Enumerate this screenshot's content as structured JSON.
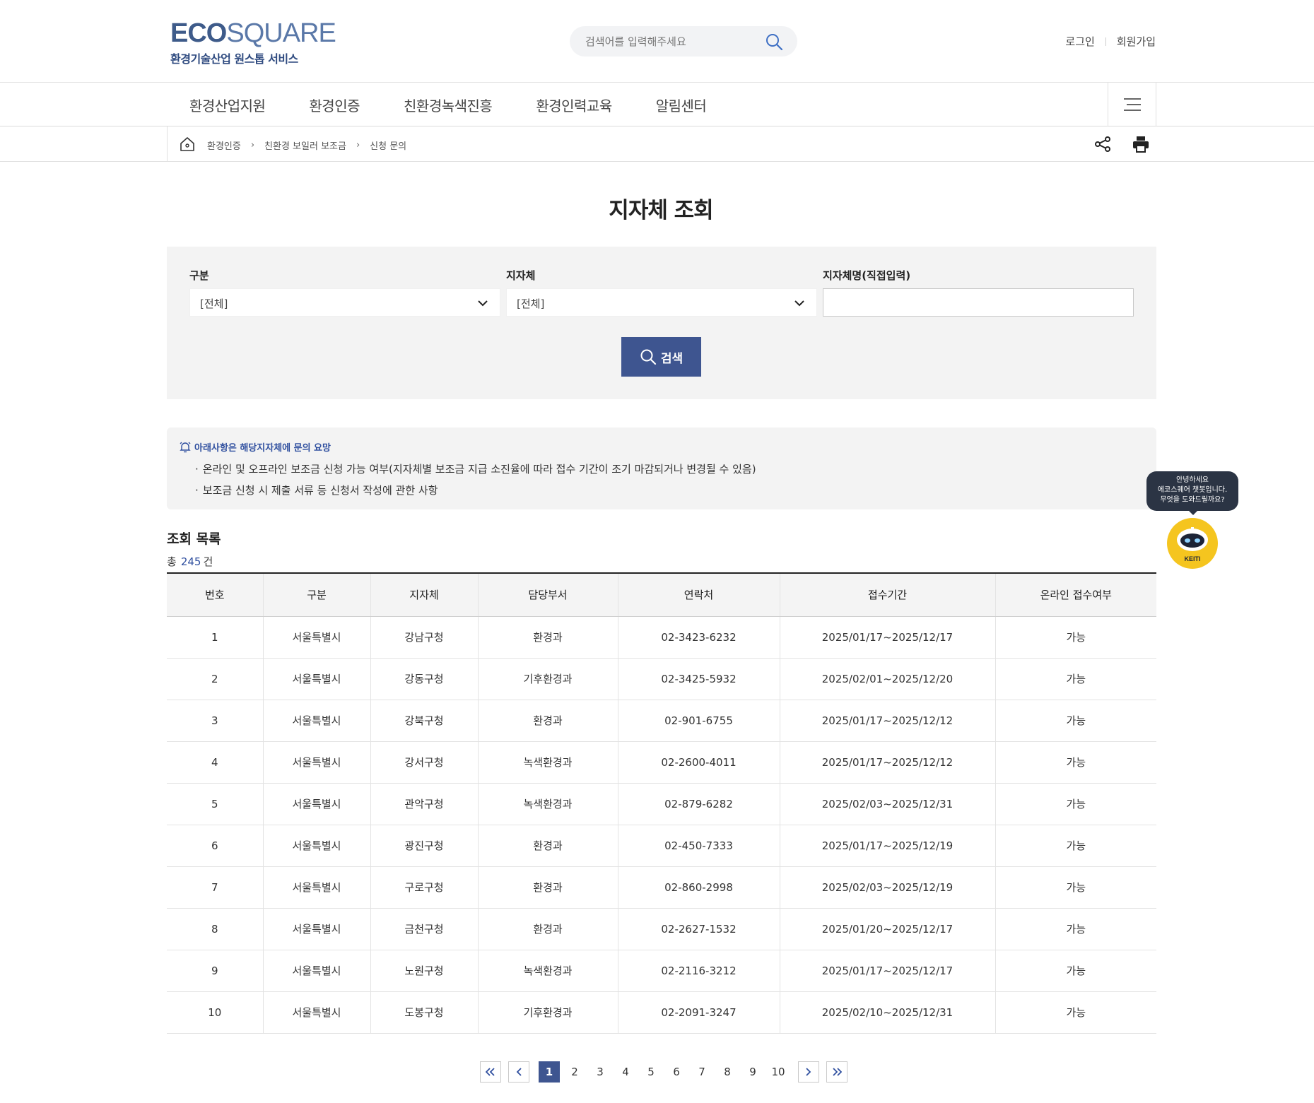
{
  "header": {
    "logo_main_bold": "ECO",
    "logo_main_light": "SQUARE",
    "logo_sub": "환경기술산업 원스톱 서비스",
    "search_placeholder": "검색어를 입력해주세요",
    "login": "로그인",
    "signup": "회원가입"
  },
  "gnb": {
    "items": [
      "환경산업지원",
      "환경인증",
      "친환경녹색진흥",
      "환경인력교육",
      "알림센터"
    ]
  },
  "breadcrumb": [
    "환경인증",
    "친환경 보일러 보조금",
    "신청 문의"
  ],
  "page_title": "지자체 조회",
  "filter": {
    "category_label": "구분",
    "category_value": "[전체]",
    "municipality_label": "지자체",
    "municipality_value": "[전체]",
    "name_label": "지자체명(직접입력)",
    "name_value": "",
    "search_button": "검색"
  },
  "notice": {
    "heading": "아래사항은 해당지자체에 문의 요망",
    "items": [
      "온라인 및 오프라인 보조금 신청 가능 여부(지자체별 보조금 지급 소진율에 따라 접수 기간이 조기 마감되거나 변경될 수 있음)",
      "보조금 신청 시 제출 서류 등 신청서 작성에 관한 사항"
    ]
  },
  "list": {
    "title": "조회 목록",
    "total_prefix": "총",
    "total_count": "245",
    "total_suffix": "건",
    "columns": [
      "번호",
      "구분",
      "지자체",
      "담당부서",
      "연락처",
      "접수기간",
      "온라인 접수여부"
    ],
    "rows": [
      [
        "1",
        "서울특별시",
        "강남구청",
        "환경과",
        "02-3423-6232",
        "2025/01/17~2025/12/17",
        "가능"
      ],
      [
        "2",
        "서울특별시",
        "강동구청",
        "기후환경과",
        "02-3425-5932",
        "2025/02/01~2025/12/20",
        "가능"
      ],
      [
        "3",
        "서울특별시",
        "강북구청",
        "환경과",
        "02-901-6755",
        "2025/01/17~2025/12/12",
        "가능"
      ],
      [
        "4",
        "서울특별시",
        "강서구청",
        "녹색환경과",
        "02-2600-4011",
        "2025/01/17~2025/12/12",
        "가능"
      ],
      [
        "5",
        "서울특별시",
        "관악구청",
        "녹색환경과",
        "02-879-6282",
        "2025/02/03~2025/12/31",
        "가능"
      ],
      [
        "6",
        "서울특별시",
        "광진구청",
        "환경과",
        "02-450-7333",
        "2025/01/17~2025/12/19",
        "가능"
      ],
      [
        "7",
        "서울특별시",
        "구로구청",
        "환경과",
        "02-860-2998",
        "2025/02/03~2025/12/19",
        "가능"
      ],
      [
        "8",
        "서울특별시",
        "금천구청",
        "환경과",
        "02-2627-1532",
        "2025/01/20~2025/12/17",
        "가능"
      ],
      [
        "9",
        "서울특별시",
        "노원구청",
        "녹색환경과",
        "02-2116-3212",
        "2025/01/17~2025/12/17",
        "가능"
      ],
      [
        "10",
        "서울특별시",
        "도봉구청",
        "기후환경과",
        "02-2091-3247",
        "2025/02/10~2025/12/31",
        "가능"
      ]
    ]
  },
  "paging": {
    "current": "1",
    "pages": [
      "1",
      "2",
      "3",
      "4",
      "5",
      "6",
      "7",
      "8",
      "9",
      "10"
    ]
  },
  "chatbot": {
    "bubble_lines": [
      "안녕하세요",
      "에코스퀘어 챗봇입니다.",
      "무엇을 도와드릴까요?"
    ],
    "badge": "KEITI"
  },
  "colors": {
    "primary": "#3e5590",
    "notice_blue": "#2f4f9f",
    "panel_bg": "#f3f3f3",
    "chatbot_yellow": "#f5c51f"
  }
}
